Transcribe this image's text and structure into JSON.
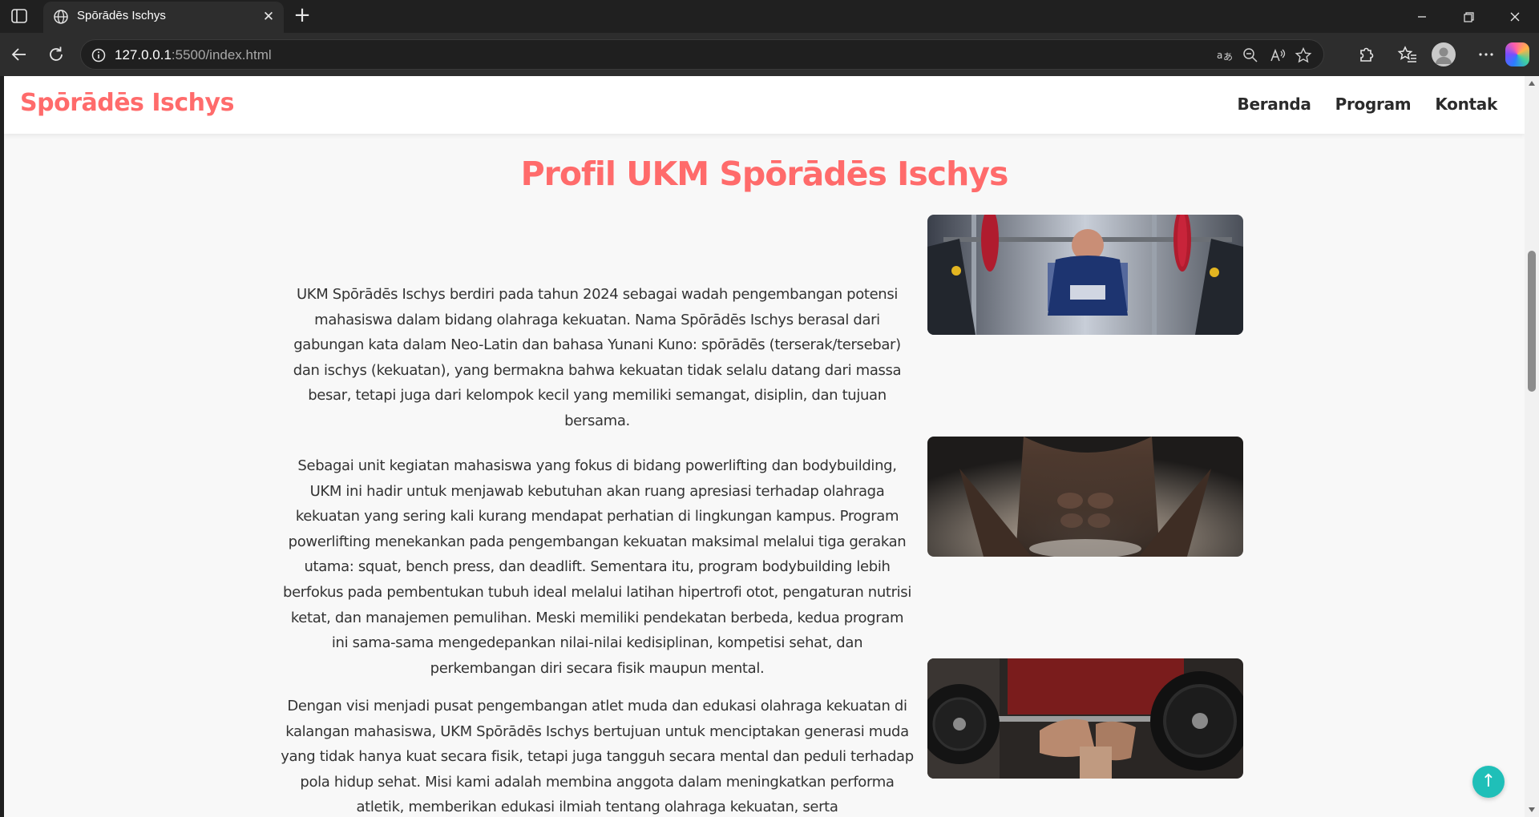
{
  "browser": {
    "tab_title": "Spōrādēs Ischys",
    "url_host": "127.0.0.1",
    "url_path": ":5500/index.html",
    "icons": [
      "sidebar-toggle-icon",
      "globe-icon",
      "close-icon",
      "plus-icon",
      "minimize-icon",
      "restore-icon",
      "close-window-icon",
      "back-icon",
      "reload-icon",
      "info-icon",
      "translate-icon",
      "zoom-out-icon",
      "read-aloud-icon",
      "star-icon",
      "extensions-icon",
      "favorites-icon",
      "profile-icon",
      "more-icon",
      "copilot-icon"
    ]
  },
  "site": {
    "brand": "Spōrādēs Ischys",
    "nav": [
      "Beranda",
      "Program",
      "Kontak"
    ],
    "brand_color": "#ff6b6b",
    "accent_color": "#1fbfb8"
  },
  "profile": {
    "title": "Profil UKM Spōrādēs Ischys",
    "paragraphs": [
      "UKM Spōrādēs Ischys berdiri pada tahun 2024 sebagai wadah pengembangan potensi mahasiswa dalam bidang olahraga kekuatan. Nama Spōrādēs Ischys berasal dari gabungan kata dalam Neo-Latin dan bahasa Yunani Kuno: spōrādēs (terserak/tersebar) dan ischys (kekuatan), yang bermakna bahwa kekuatan tidak selalu datang dari massa besar, tetapi juga dari kelompok kecil yang memiliki semangat, disiplin, dan tujuan bersama.",
      "Sebagai unit kegiatan mahasiswa yang fokus di bidang powerlifting dan bodybuilding, UKM ini hadir untuk menjawab kebutuhan akan ruang apresiasi terhadap olahraga kekuatan yang sering kali kurang mendapat perhatian di lingkungan kampus. Program powerlifting menekankan pada pengembangan kekuatan maksimal melalui tiga gerakan utama: squat, bench press, dan deadlift. Sementara itu, program bodybuilding lebih berfokus pada pembentukan tubuh ideal melalui latihan hipertrofi otot, pengaturan nutrisi ketat, dan manajemen pemulihan. Meski memiliki pendekatan berbeda, kedua program ini sama-sama mengedepankan nilai-nilai kedisiplinan, kompetisi sehat, dan perkembangan diri secara fisik maupun mental.",
      "Dengan visi menjadi pusat pengembangan atlet muda dan edukasi olahraga kekuatan di kalangan mahasiswa, UKM Spōrādēs Ischys bertujuan untuk menciptakan generasi muda yang tidak hanya kuat secara fisik, tetapi juga tangguh secara mental dan peduli terhadap pola hidup sehat. Misi kami adalah membina anggota dalam meningkatkan performa atletik, memberikan edukasi ilmiah tentang olahraga kekuatan, serta"
    ]
  },
  "back_to_top": "↑"
}
